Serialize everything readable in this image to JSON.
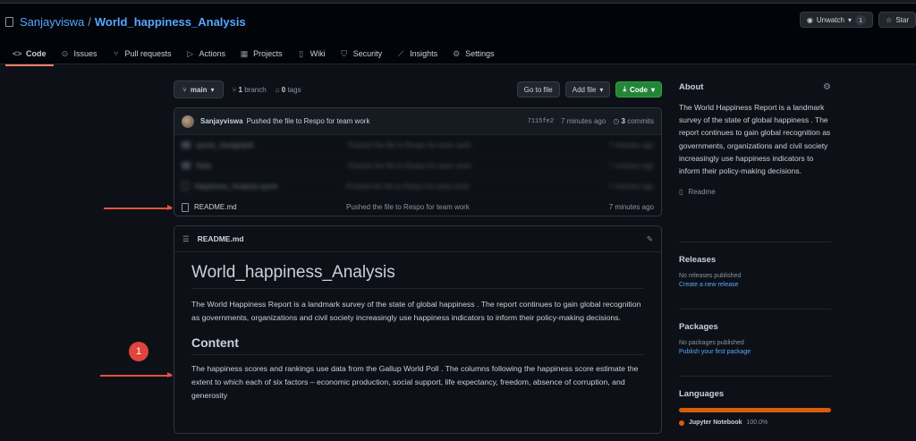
{
  "repo": {
    "owner": "Sanjayviswa",
    "separator": "/",
    "name": "World_happiness_Analysis"
  },
  "header_buttons": {
    "watch_label": "Unwatch",
    "watch_count": "1",
    "star_label": "Star"
  },
  "tabs": [
    {
      "label": "Code",
      "icon": "code-icon"
    },
    {
      "label": "Issues",
      "icon": "issue-icon"
    },
    {
      "label": "Pull requests",
      "icon": "pull-request-icon"
    },
    {
      "label": "Actions",
      "icon": "play-icon"
    },
    {
      "label": "Projects",
      "icon": "project-icon"
    },
    {
      "label": "Wiki",
      "icon": "book-icon"
    },
    {
      "label": "Security",
      "icon": "shield-icon"
    },
    {
      "label": "Insights",
      "icon": "graph-icon"
    },
    {
      "label": "Settings",
      "icon": "gear-icon"
    }
  ],
  "branch_bar": {
    "branch": "main",
    "branch_count": "1",
    "branch_word": "branch",
    "tag_count": "0",
    "tag_word": "tags",
    "go_to_file": "Go to file",
    "add_file": "Add file",
    "code": "Code"
  },
  "latest_commit": {
    "user": "Sanjayviswa",
    "message": "Pushed the file to Respo for team work",
    "sha": "7115fe2",
    "time": "7 minutes ago",
    "commit_count": "3",
    "commit_word": "commits"
  },
  "files": [
    {
      "name": "sports_rbudgetpdt",
      "message": "Pushed the file to Respo for team work",
      "time": "7 minutes ago",
      "blurred": true,
      "type": "folder"
    },
    {
      "name": "Data",
      "message": "Pushed the file to Respo for team work",
      "time": "7 minutes ago",
      "blurred": true,
      "type": "folder"
    },
    {
      "name": "Happiness_Analysis.ipynb",
      "message": "Pushed the file to Respo for team work",
      "time": "7 minutes ago",
      "blurred": true,
      "type": "file"
    },
    {
      "name": "README.md",
      "message": "Pushed the file to Respo for team work",
      "time": "7 minutes ago",
      "blurred": false,
      "type": "file"
    }
  ],
  "readme": {
    "filename": "README.md",
    "title": "World_happiness_Analysis",
    "intro": "The World Happiness Report is a landmark survey of the state of global happiness . The report continues to gain global recognition as governments, organizations and civil society increasingly use happiness indicators to inform their policy-making decisions.",
    "content_heading": "Content",
    "content_text": "The happiness scores and rankings use data from the Gallup World Poll . The columns following the happiness score estimate the extent to which each of six factors – economic production, social support, life expectancy, freedom, absence of corruption, and generosity"
  },
  "about": {
    "heading": "About",
    "description": "The World Happiness Report is a landmark survey of the state of global happiness . The report continues to gain global recognition as governments, organizations and civil society increasingly use happiness indicators to inform their policy-making decisions.",
    "readme_link": "Readme"
  },
  "releases": {
    "heading": "Releases",
    "status": "No releases published",
    "link": "Create a new release"
  },
  "packages": {
    "heading": "Packages",
    "status": "No packages published",
    "link": "Publish your first package"
  },
  "languages": {
    "heading": "Languages",
    "items": [
      {
        "name": "Jupyter Notebook",
        "percent": "100.0%",
        "color": "#DA5B0B",
        "fraction": 1.0
      }
    ]
  },
  "annotation": {
    "badge_number": "1",
    "arrow_color": "#e5533d"
  },
  "colors": {
    "accent": "#58a6ff",
    "primary_button": "#238636",
    "active_tab_underline": "#f78166"
  }
}
